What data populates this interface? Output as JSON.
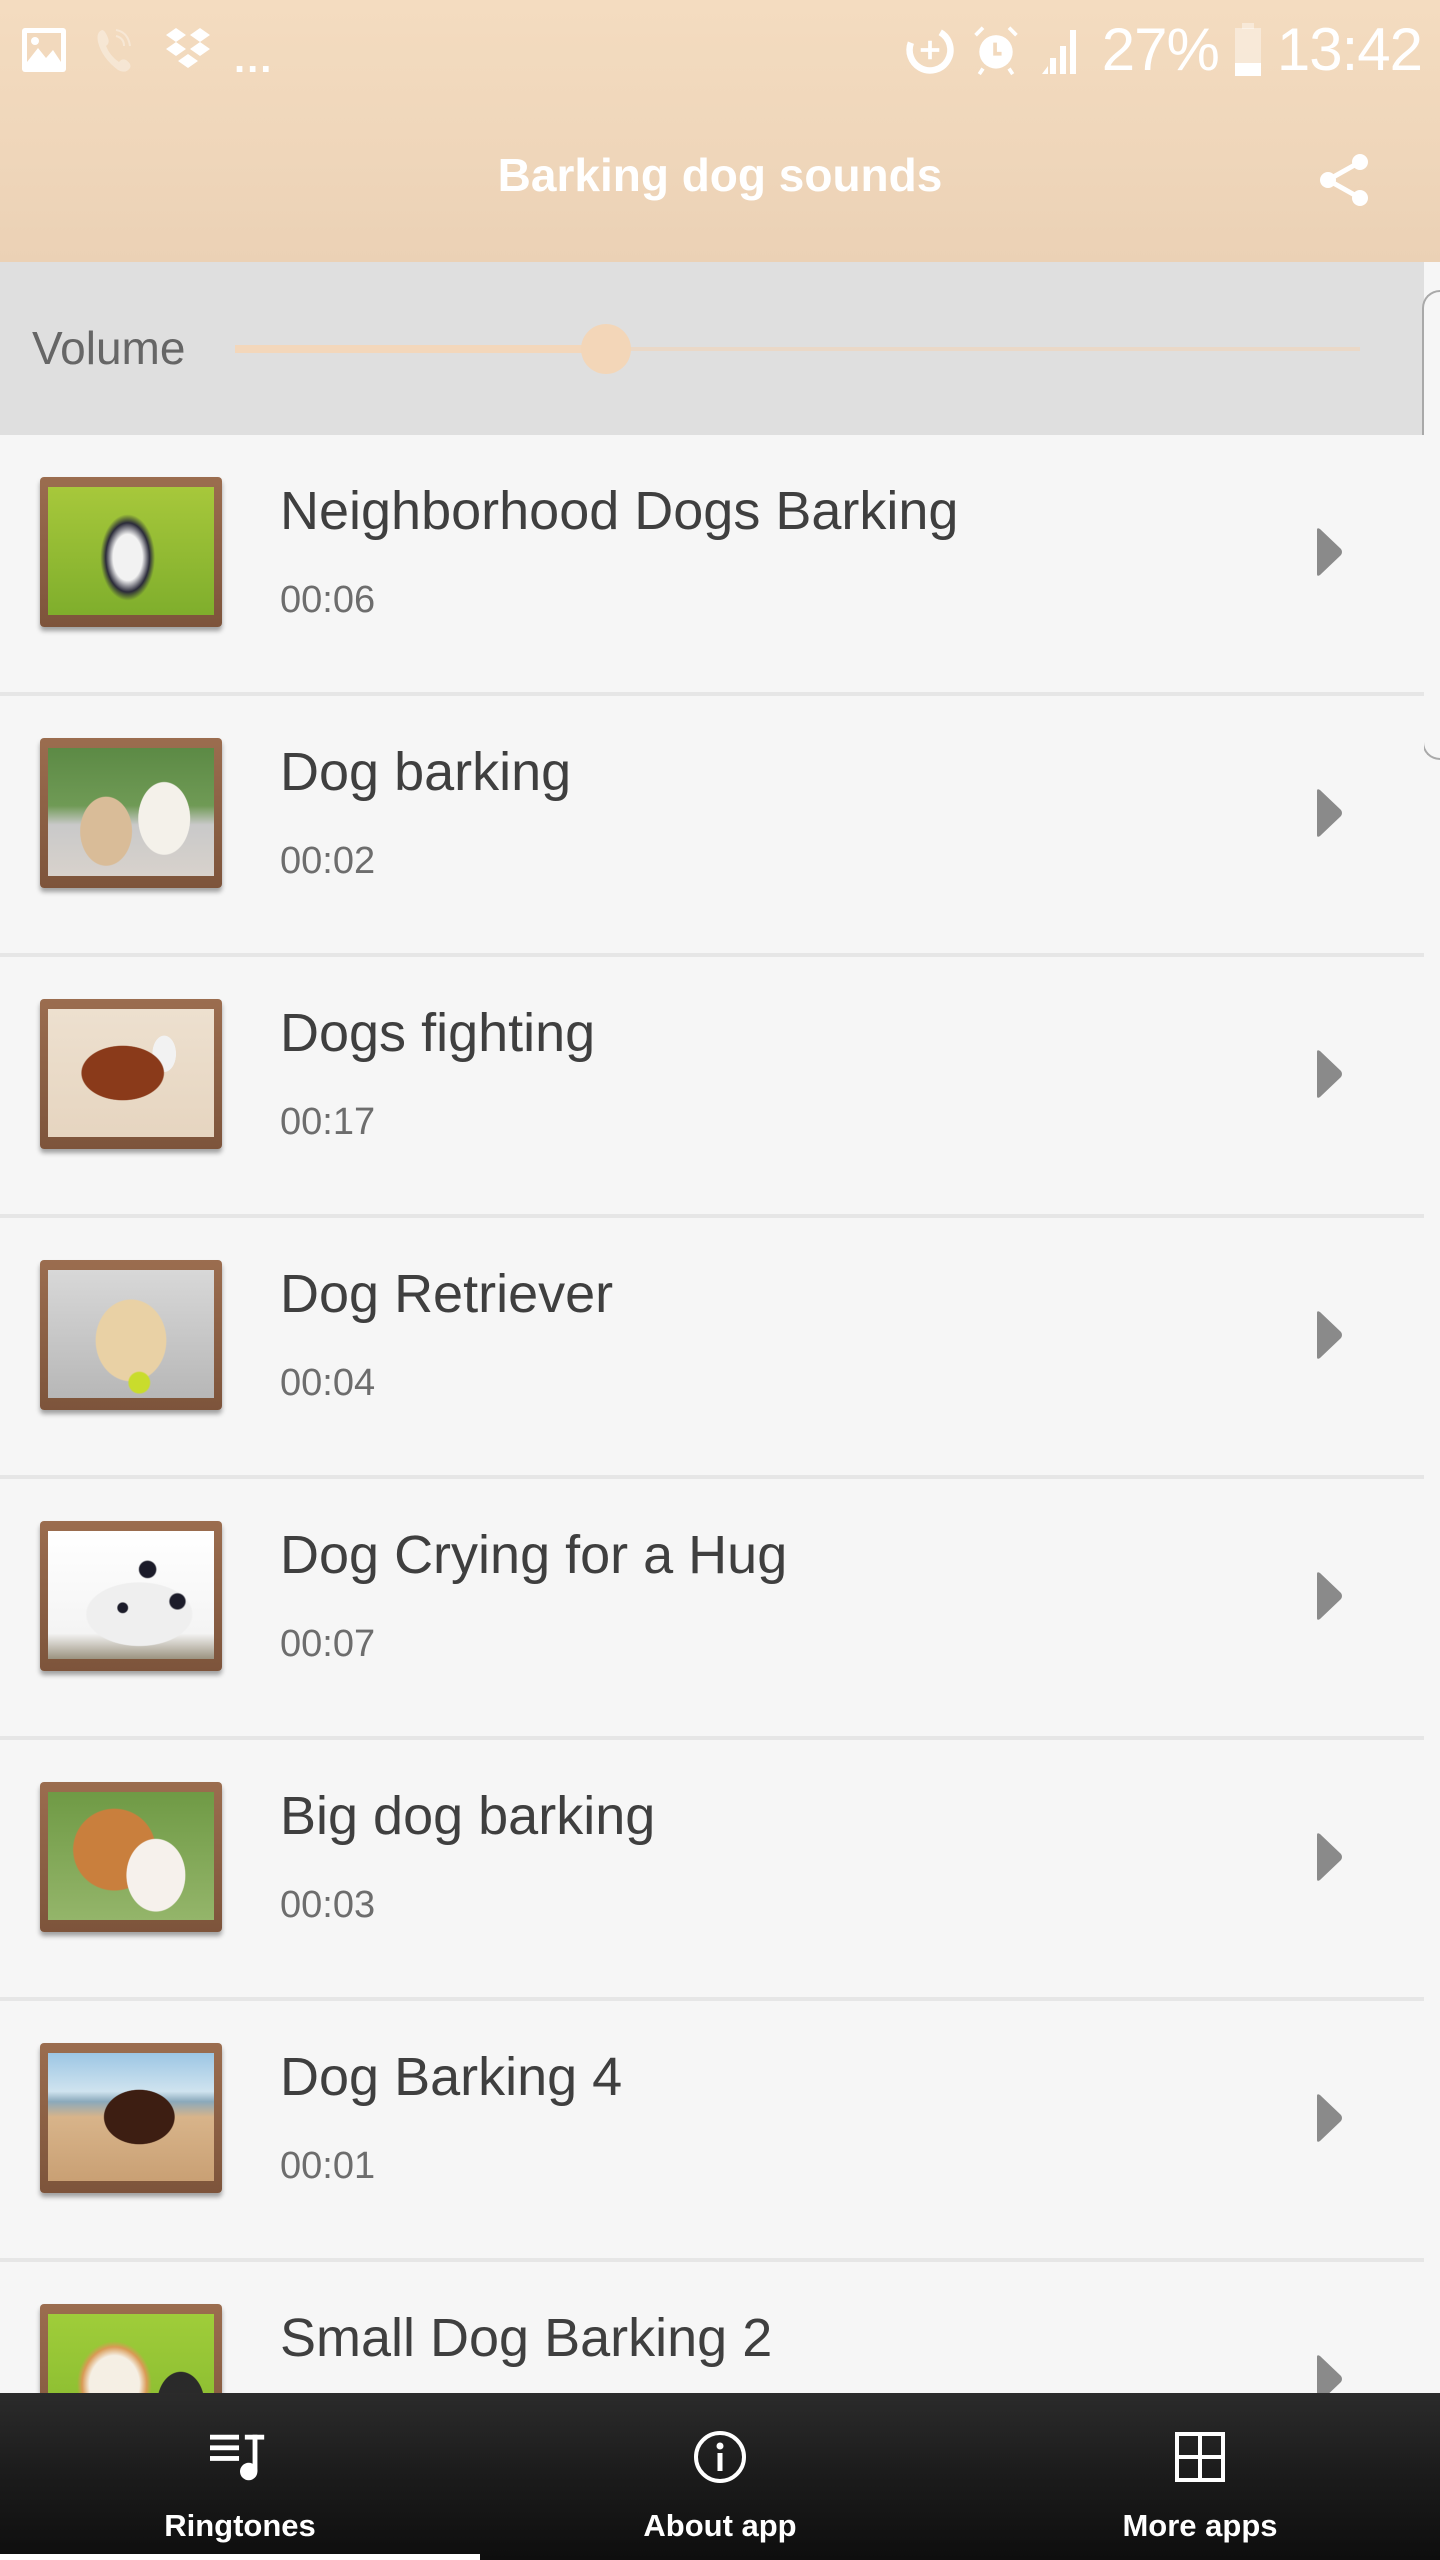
{
  "status_bar": {
    "left_icons": [
      "gallery-icon",
      "viber-icon",
      "dropbox-icon"
    ],
    "overflow": "...",
    "right_icons": [
      "data-saver-icon",
      "alarm-icon",
      "signal-icon"
    ],
    "battery_percent": "27%",
    "battery_level": 0.27,
    "time": "13:42"
  },
  "app_bar": {
    "title": "Barking dog sounds",
    "share_icon": "share-icon"
  },
  "volume": {
    "label": "Volume",
    "value": 0.33
  },
  "colors": {
    "header_top": "#f4dcc0",
    "header_bottom": "#ebd1b5",
    "accent": "#f3d6b8",
    "list_bg": "#f6f6f6",
    "title_text": "#3f3f3f",
    "duration_text": "#6d6d6d",
    "play_icon": "#8a8a8a",
    "bottom_nav_bg": "#1b1b1b"
  },
  "sounds": [
    {
      "title": "Neighborhood Dogs Barking",
      "duration": "00:06",
      "thumbnail": "husky-puppy-on-grass"
    },
    {
      "title": "Dog barking",
      "duration": "00:02",
      "thumbnail": "two-dogs-sitting"
    },
    {
      "title": "Dogs fighting",
      "duration": "00:17",
      "thumbnail": "boston-terrier-on-sand"
    },
    {
      "title": "Dog Retriever",
      "duration": "00:04",
      "thumbnail": "labrador-with-ball"
    },
    {
      "title": "Dog Crying for a Hug",
      "duration": "00:07",
      "thumbnail": "dalmatian-head"
    },
    {
      "title": "Big dog barking",
      "duration": "00:03",
      "thumbnail": "spaniel-puppy"
    },
    {
      "title": "Dog Barking 4",
      "duration": "00:01",
      "thumbnail": "chocolate-lab-on-beach"
    },
    {
      "title": "Small Dog Barking 2",
      "duration": "",
      "thumbnail": "corgi-on-grass"
    }
  ],
  "bottom_nav": [
    {
      "label": "Ringtones",
      "icon": "ringtones-icon",
      "active": true
    },
    {
      "label": "About app",
      "icon": "info-icon",
      "active": false
    },
    {
      "label": "More apps",
      "icon": "grid-icon",
      "active": false
    }
  ]
}
